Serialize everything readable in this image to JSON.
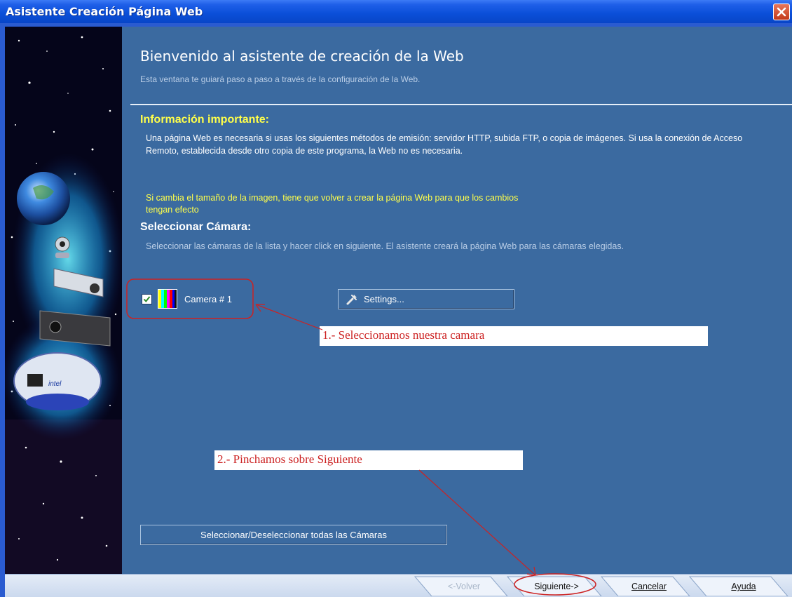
{
  "window": {
    "title": "Asistente Creación Página Web",
    "close_icon": "close-icon"
  },
  "header": {
    "heading": "Bienvenido al asistente de creación de la Web",
    "subtitle": "Esta ventana te guiará paso a paso a través de la configuración de la Web."
  },
  "info": {
    "title": "Información importante:",
    "text": "Una página Web es necesaria si usas los siguientes métodos de emisión: servidor HTTP, subida FTP, o copia de imágenes. Si usa la conexión de Acceso Remoto, establecida desde otro copia de este programa, la Web no es necesaria.",
    "warning_line1": "Si cambia el tamaño de la imagen, tiene que volver a crear la página Web para que los cambios",
    "warning_line2": "tengan efecto"
  },
  "camera_select": {
    "title": "Seleccionar Cámara:",
    "text": "Seleccionar las cámaras de la lista y hacer click en siguiente. El asistente creará la página Web para las cámaras elegidas.",
    "cameras": [
      {
        "label": "Camera # 1",
        "checked": true
      }
    ],
    "settings_label": "Settings...",
    "select_all_label": "Seleccionar/Deseleccionar todas las Cámaras"
  },
  "footer": {
    "back_label": "<-Volver",
    "next_label": "Siguiente->",
    "cancel_label": "Cancelar",
    "help_label": "Ayuda"
  },
  "annotations": {
    "step1": "1.- Seleccionamos nuestra camara",
    "step2": "2.- Pinchamos sobre Siguiente"
  },
  "colors": {
    "panel": "#3b6aa0",
    "highlight_yellow": "#ffff4a",
    "annotation_red": "#cc2222"
  }
}
